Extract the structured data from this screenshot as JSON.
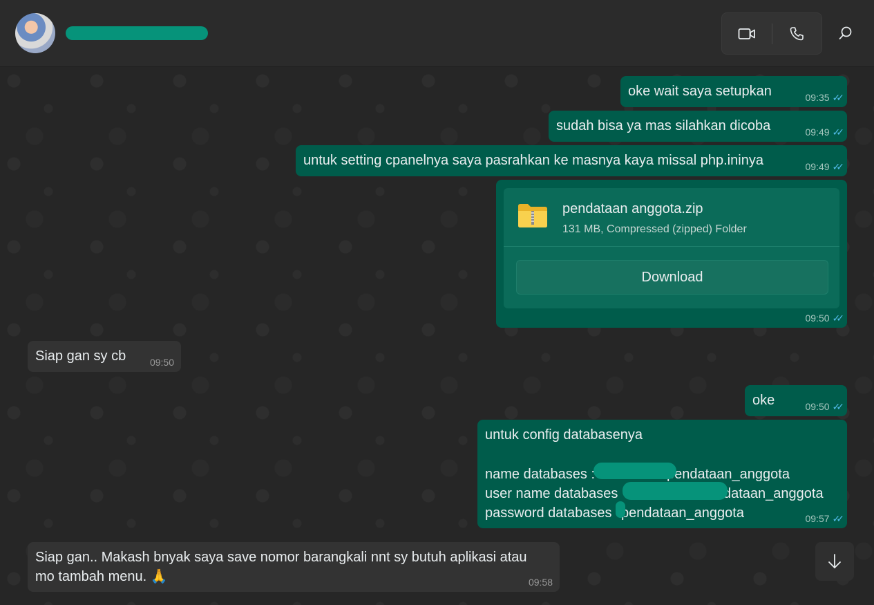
{
  "header": {
    "contact_avatar": "contact-avatar",
    "icons": {
      "video": "video-call-icon",
      "voice": "voice-call-icon",
      "search": "search-icon"
    }
  },
  "colors": {
    "outgoing": "#005c4b",
    "incoming": "#333333",
    "ticks": "#53bdeb",
    "redact": "#06937a"
  },
  "messages": [
    {
      "text": "oke wait saya setupkan",
      "time": "09:35"
    },
    {
      "text": "sudah bisa ya mas silahkan dicoba",
      "time": "09:49"
    },
    {
      "text": "untuk setting cpanelnya saya pasrahkan ke masnya kaya missal php.ininya",
      "time": "09:49"
    },
    {
      "file_name": "pendataan anggota.zip",
      "file_info": "131 MB, Compressed (zipped) Folder",
      "download_label": "Download",
      "time": "09:50"
    },
    {
      "text": "Siap gan sy cb",
      "time": "09:50"
    },
    {
      "text": "oke",
      "time": "09:50"
    },
    {
      "line1": "untuk config databasenya",
      "line2": "name databases : ",
      "line2_tail": "pendataan_anggota",
      "line3": "user name databases ",
      "line3_tail": "dataan_anggota",
      "line4": "password databases ",
      "line4_tail": "pendataan_anggota",
      "time": "09:57"
    },
    {
      "line1": "Siap gan.. Makash bnyak saya save nomor barangkali nnt sy butuh aplikasi atau",
      "line2": "mo tambah menu. 🙏",
      "time": "09:58"
    }
  ],
  "tick_glyph": "✓✓",
  "scroll_icon": "arrow-down-icon"
}
